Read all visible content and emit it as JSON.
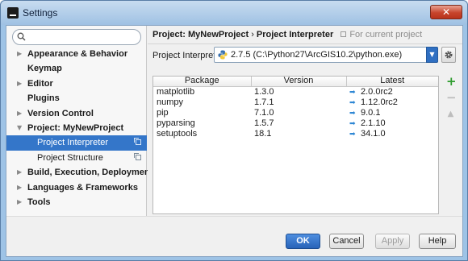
{
  "window": {
    "title": "Settings",
    "close_glyph": "✕"
  },
  "search": {
    "placeholder": "",
    "value": ""
  },
  "sidebar": {
    "items": [
      {
        "label": "Appearance & Behavior",
        "arrow": "▶"
      },
      {
        "label": "Keymap",
        "arrow": ""
      },
      {
        "label": "Editor",
        "arrow": "▶"
      },
      {
        "label": "Plugins",
        "arrow": ""
      },
      {
        "label": "Version Control",
        "arrow": "▶"
      },
      {
        "label": "Project: MyNewProject",
        "arrow": "▼"
      },
      {
        "label": "Project Interpreter",
        "arrow": "",
        "selected": true
      },
      {
        "label": "Project Structure",
        "arrow": ""
      },
      {
        "label": "Build, Execution, Deployment",
        "arrow": "▶"
      },
      {
        "label": "Languages & Frameworks",
        "arrow": "▶"
      },
      {
        "label": "Tools",
        "arrow": "▶"
      }
    ]
  },
  "breadcrumb": {
    "part1": "Project: MyNewProject",
    "sep": "›",
    "part2": "Project Interpreter",
    "scope": "For current project"
  },
  "interpreter": {
    "label": "Project Interpreter:",
    "value": "2.7.5 (C:\\Python27\\ArcGIS10.2\\python.exe)",
    "dropdown_glyph": "▼"
  },
  "packages": {
    "columns": [
      "Package",
      "Version",
      "Latest"
    ],
    "rows": [
      {
        "package": "matplotlib",
        "version": "1.3.0",
        "latest": "2.0.0rc2"
      },
      {
        "package": "numpy",
        "version": "1.7.1",
        "latest": "1.12.0rc2"
      },
      {
        "package": "pip",
        "version": "7.1.0",
        "latest": "9.0.1"
      },
      {
        "package": "pyparsing",
        "version": "1.5.7",
        "latest": "2.1.10"
      },
      {
        "package": "setuptools",
        "version": "18.1",
        "latest": "34.1.0"
      }
    ],
    "update_glyph": "➡"
  },
  "tools": {
    "add": "+",
    "remove": "−",
    "upgrade": "▲"
  },
  "buttons": {
    "ok": "OK",
    "cancel": "Cancel",
    "apply": "Apply",
    "help": "Help"
  },
  "colors": {
    "selection": "#3476c9",
    "accent": "#2f6fc2",
    "update_arrow": "#2e87d4",
    "add_green": "#2e9c2e"
  }
}
